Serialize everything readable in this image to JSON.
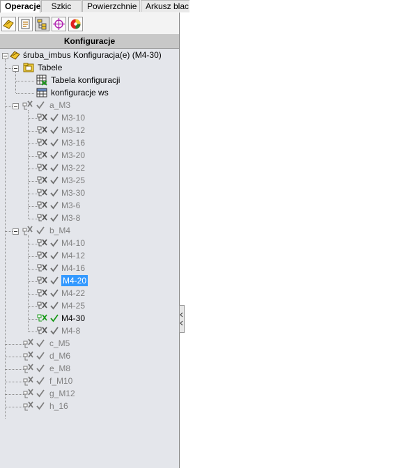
{
  "tabs": [
    "Operacje",
    "Szkic",
    "Powierzchnie",
    "Arkusz blac"
  ],
  "toolbar_icons": [
    "feature-manager-icon",
    "property-manager-icon",
    "configuration-manager-icon",
    "dimxpert-icon",
    "display-manager-icon"
  ],
  "panel": {
    "title": "Konfiguracje"
  },
  "tree": {
    "root": "śruba_imbus Konfiguracja(e)  (M4-30)",
    "tables": {
      "label": "Tabele",
      "items": [
        "Tabela konfiguracji",
        "konfiguracje ws"
      ]
    },
    "groups": [
      {
        "label": "a_M3",
        "children": [
          "M3-10",
          "M3-12",
          "M3-16",
          "M3-20",
          "M3-22",
          "M3-25",
          "M3-30",
          "M3-6",
          "M3-8"
        ]
      },
      {
        "label": "b_M4",
        "children": [
          "M4-10",
          "M4-12",
          "M4-16",
          "M4-20",
          "M4-22",
          "M4-25",
          "M4-30",
          "M4-8"
        ]
      },
      {
        "label": "c_M5",
        "children": []
      },
      {
        "label": "d_M6",
        "children": []
      },
      {
        "label": "e_M8",
        "children": []
      },
      {
        "label": "f_M10",
        "children": []
      },
      {
        "label": "g_M12",
        "children": []
      },
      {
        "label": "h_16",
        "children": []
      }
    ],
    "selected": "M4-20",
    "active": "M4-30"
  },
  "colors": {
    "tree_bg": "#e4e6eb",
    "selection": "#3399ff",
    "active_check": "#1a9a1a",
    "dim_text": "#7f7f7f"
  }
}
